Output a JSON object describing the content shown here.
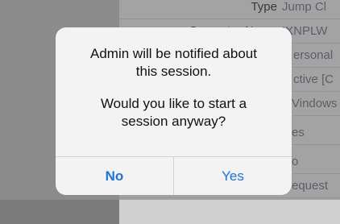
{
  "background": {
    "rows": [
      {
        "label": "Type",
        "value": "Jump Cl"
      },
      {
        "label": "Computer Name",
        "value": "IXNPLW"
      },
      {
        "label": "",
        "value": "ersonal"
      },
      {
        "label": "",
        "value": "ctive [C"
      },
      {
        "label": "",
        "value": "Vindows"
      },
      {
        "label": "",
        "value": "es"
      },
      {
        "label": "",
        "value": "o"
      },
      {
        "label": "",
        "value": "equest"
      }
    ]
  },
  "alert": {
    "line1": "Admin will be notified about",
    "line2": "this session.",
    "line3": "Would you like to start a",
    "line4": "session anyway?",
    "no_label": "No",
    "yes_label": "Yes",
    "accent_color": "#1a73e8"
  }
}
